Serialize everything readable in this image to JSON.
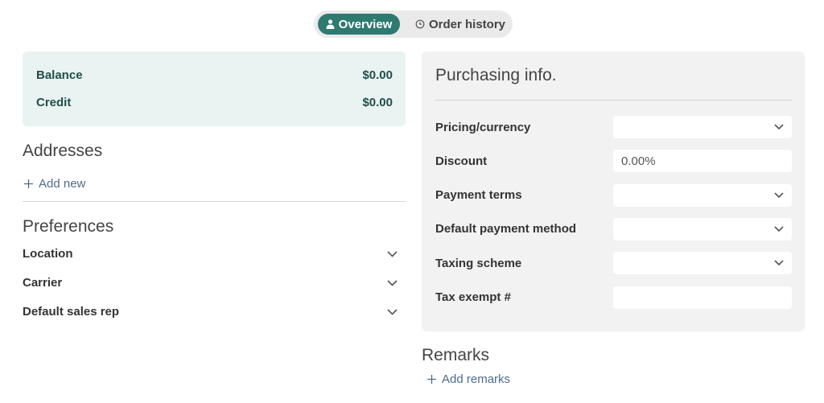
{
  "tabs": {
    "overview": "Overview",
    "history": "Order history"
  },
  "balance": {
    "balance_label": "Balance",
    "balance_value": "$0.00",
    "credit_label": "Credit",
    "credit_value": "$0.00"
  },
  "addresses": {
    "title": "Addresses",
    "add_label": "Add new"
  },
  "preferences": {
    "title": "Preferences",
    "items": [
      "Location",
      "Carrier",
      "Default sales rep"
    ]
  },
  "purchasing": {
    "title": "Purchasing info.",
    "pricing_label": "Pricing/currency",
    "pricing_value": "",
    "discount_label": "Discount",
    "discount_value": "0.00%",
    "payment_terms_label": "Payment terms",
    "payment_terms_value": "",
    "payment_method_label": "Default payment method",
    "payment_method_value": "",
    "taxing_label": "Taxing scheme",
    "taxing_value": "",
    "tax_exempt_label": "Tax exempt #",
    "tax_exempt_value": ""
  },
  "remarks": {
    "title": "Remarks",
    "add_label": "Add remarks"
  },
  "colors": {
    "accent": "#2e7a71",
    "balance_bg": "#e9f3f2",
    "panel_bg": "#f2f2f2",
    "link": "#4f6b8c"
  }
}
